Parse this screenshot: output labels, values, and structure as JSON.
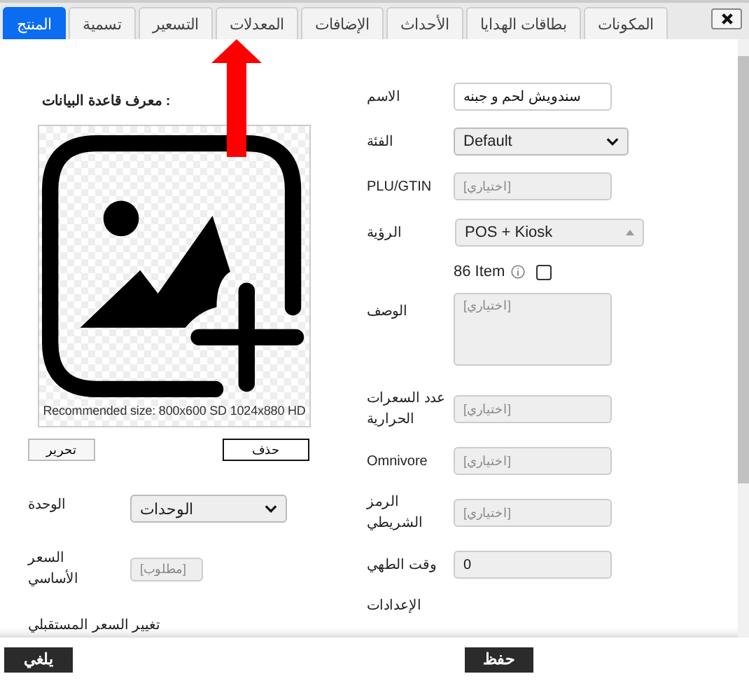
{
  "tabs": [
    {
      "label": "المكونات",
      "selected": false
    },
    {
      "label": "بطاقات الهدايا",
      "selected": false
    },
    {
      "label": "الأحداث",
      "selected": false
    },
    {
      "label": "الإضافات",
      "selected": false
    },
    {
      "label": "المعدلات",
      "selected": false
    },
    {
      "label": "التسعير",
      "selected": false
    },
    {
      "label": "تسمية",
      "selected": false
    },
    {
      "label": "المنتج",
      "selected": true
    }
  ],
  "database_id_label": "معرف قاعدة البيانات :",
  "image": {
    "caption": "Recommended size: 800x600 SD 1024x880 HD"
  },
  "image_buttons": [
    {
      "label": "حذف",
      "kind": "outlined"
    },
    {
      "label": "تحرير",
      "kind": "plain"
    }
  ],
  "left_fields": [
    {
      "kind": "select",
      "label": "الوحدة",
      "value": "الوحدات"
    },
    {
      "kind": "input",
      "label": "السعر الأساسي",
      "placeholder": "[مطلوب]"
    },
    {
      "kind": "heading",
      "label": "تغيير السعر المستقبلي"
    }
  ],
  "fields": [
    {
      "kind": "input",
      "label": "الاسم",
      "value": "سندويش لحم و جبنه"
    },
    {
      "kind": "select",
      "label": "الفئة",
      "value": "Default"
    },
    {
      "kind": "input",
      "label": "PLU/GTIN",
      "placeholder": "[اختياري]"
    },
    {
      "kind": "multiselect",
      "label": "الرؤية",
      "value": "POS + Kiosk",
      "option": {
        "label": "86 Item",
        "checked": false
      }
    },
    {
      "kind": "textarea",
      "label": "الوصف",
      "placeholder": "[اختياري]"
    },
    {
      "kind": "input",
      "label": "عدد السعرات الحرارية",
      "placeholder": "[اختياري]"
    },
    {
      "kind": "input",
      "label": "Omnivore",
      "placeholder": "[اختياري]"
    },
    {
      "kind": "input",
      "label": "الرمز الشريطي",
      "placeholder": "[اختياري]"
    },
    {
      "kind": "input",
      "label": "وقت الطهي",
      "value": "0"
    },
    {
      "kind": "heading",
      "label": "الإعدادات"
    }
  ],
  "footer": {
    "cancel": "يلغي",
    "save": "حفظ"
  }
}
